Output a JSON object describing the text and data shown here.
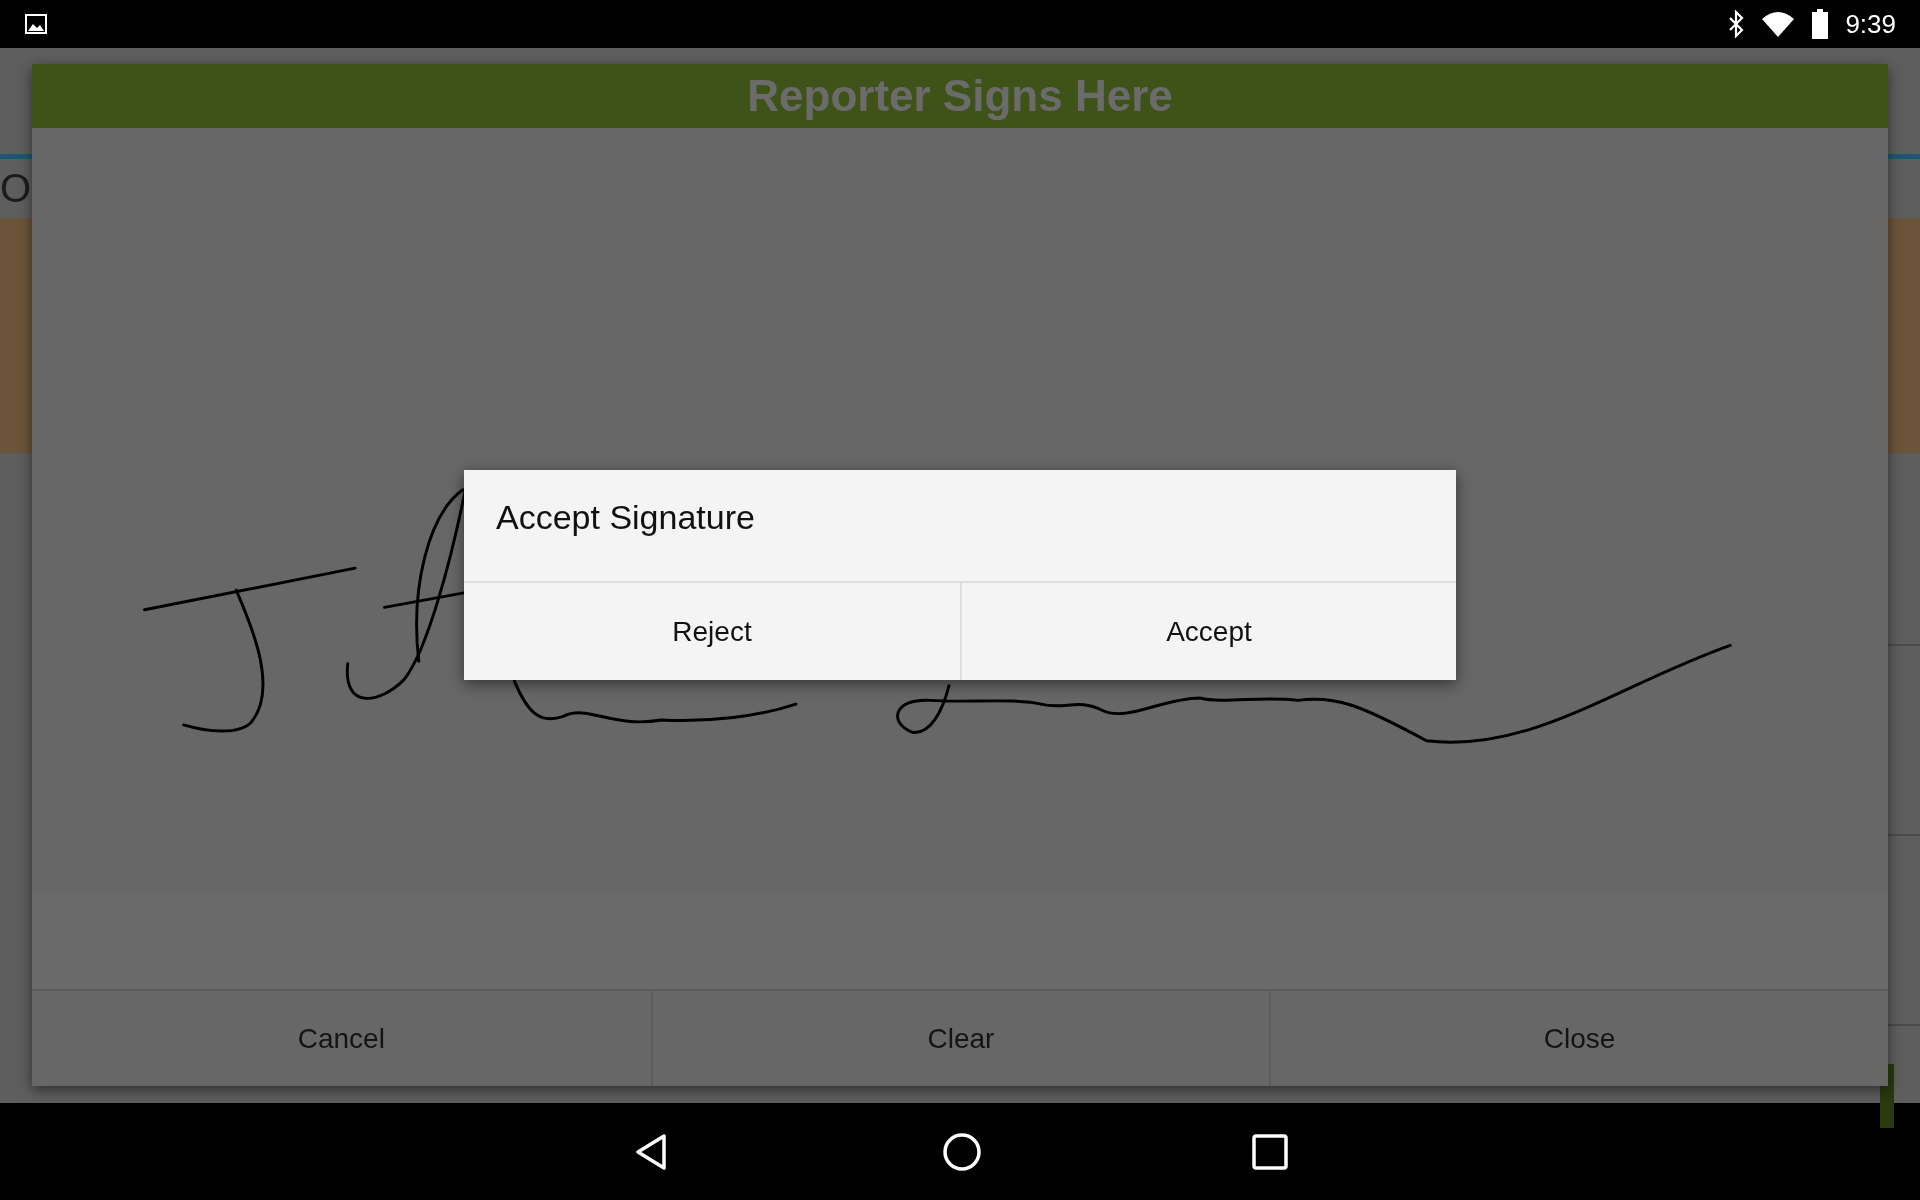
{
  "status_bar": {
    "time": "9:39"
  },
  "background_app": {
    "texts": [
      "O"
    ]
  },
  "signature_dialog": {
    "title": "Reporter Signs Here",
    "buttons": [
      "Cancel",
      "Clear",
      "Close"
    ]
  },
  "alert": {
    "title": "Accept Signature",
    "buttons": [
      "Reject",
      "Accept"
    ]
  }
}
